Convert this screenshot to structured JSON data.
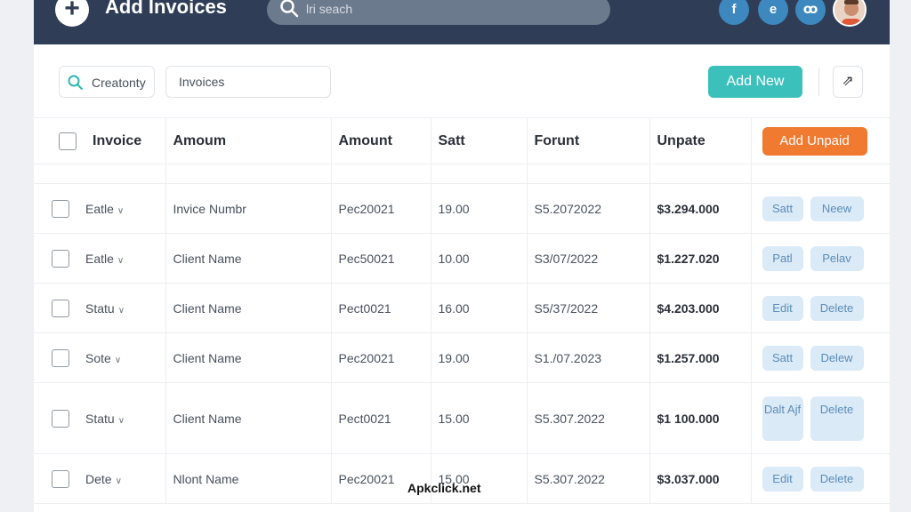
{
  "header": {
    "title": "Add Invoices",
    "search_placeholder": "lri seach",
    "social": [
      {
        "label": "f",
        "icon": "facebook-icon"
      },
      {
        "label": "e",
        "icon": "edge-icon"
      },
      {
        "label": "ꝏ",
        "icon": "link-icon"
      }
    ],
    "avatar_icon": "user-avatar"
  },
  "toolbar": {
    "filter_label": "Creatonty",
    "filter_input_value": "Invoices",
    "add_new_label": "Add New",
    "more_label": "⇗"
  },
  "table": {
    "headers": [
      "Invoice",
      "Amoum",
      "Amount",
      "Satt",
      "Forunt",
      "Unpate"
    ],
    "unpaid_button": "Add Unpaid",
    "rows": [
      {
        "status": "Eatle",
        "name": "Invice Numbr",
        "code": "Pec20021",
        "qty": "19.00",
        "date": "S5.2072022",
        "amount": "$3.294.000",
        "act1": "Satt",
        "act2": "Neew"
      },
      {
        "status": "Eatle",
        "name": "Client Name",
        "code": "Pec50021",
        "qty": "10.00",
        "date": "S3/07/2022",
        "amount": "$1.227.020",
        "act1": "Patl",
        "act2": "Pelav"
      },
      {
        "status": "Statu",
        "name": "Client Name",
        "code": "Pect0021",
        "qty": "16.00",
        "date": "S5/37/2022",
        "amount": "$4.203.000",
        "act1": "Edit",
        "act2": "Delete"
      },
      {
        "status": "Sote",
        "name": "Client Name",
        "code": "Pec20021",
        "qty": "19.00",
        "date": "S1./07.2023",
        "amount": "$1.257.000",
        "act1": "Satt",
        "act2": "Delew"
      },
      {
        "status": "Statu",
        "name": "Client Name",
        "code": "Pect0021",
        "qty": "15.00",
        "date": "S5.307.2022",
        "amount": "$1 100.000",
        "act1": "Dalt Ajf",
        "act2": "Delete"
      },
      {
        "status": "Dete",
        "name": "Nlont Name",
        "code": "Pec20021",
        "qty": "15.00",
        "date": "S5.307.2022",
        "amount": "$3.037.000",
        "act1": "Edit",
        "act2": "Delete"
      }
    ]
  },
  "watermark": "Apkclick.net",
  "colors": {
    "header_bg": "#2f3e56",
    "accent_teal": "#3cc0bb",
    "accent_orange": "#f07a30",
    "action_pill": "#daeaf7"
  }
}
